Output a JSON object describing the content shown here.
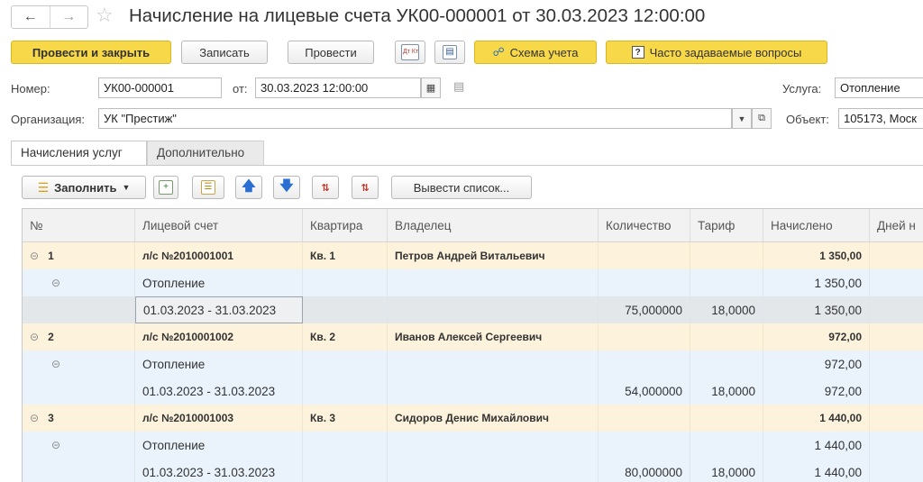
{
  "window": {
    "title": "Начисление на лицевые счета УК00-000001 от 30.03.2023 12:00:00",
    "back_icon": "arrow-left-icon",
    "forward_icon": "arrow-right-icon",
    "favorite_icon": "star-icon"
  },
  "toolbar": {
    "post_close": "Провести и закрыть",
    "save": "Записать",
    "post": "Провести",
    "dtkt_icon": "Дт Кт",
    "structure_icon": "structure-icon",
    "scheme": "Схема учета",
    "faq": "Часто задаваемые вопросы"
  },
  "form": {
    "number_label": "Номер:",
    "number_value": "УК00-000001",
    "date_label": "от:",
    "date_value": "30.03.2023 12:00:00",
    "service_label": "Услуга:",
    "service_value": "Отопление",
    "org_label": "Организация:",
    "org_value": "УК \"Престиж\"",
    "object_label": "Объект:",
    "object_value": "105173, Моск"
  },
  "tabs": [
    "Начисления услуг",
    "Дополнительно"
  ],
  "table_toolbar": {
    "fill": "Заполнить",
    "export": "Вывести список..."
  },
  "table": {
    "columns": [
      "№",
      "Лицевой счет",
      "Квартира",
      "Владелец",
      "Количество",
      "Тариф",
      "Начислено",
      "Дней н"
    ],
    "rows": [
      {
        "type": "account",
        "num": "1",
        "account": "л/с №2010001001",
        "flat": "Кв. 1",
        "owner": "Петров Андрей Витальевич",
        "qty": "",
        "tariff": "",
        "accrued": "1 350,00"
      },
      {
        "type": "service",
        "num": "",
        "account": "Отопление",
        "flat": "",
        "owner": "",
        "qty": "",
        "tariff": "",
        "accrued": "1 350,00"
      },
      {
        "type": "period",
        "num": "",
        "account": "01.03.2023 - 31.03.2023",
        "flat": "",
        "owner": "",
        "qty": "75,000000",
        "tariff": "18,0000",
        "accrued": "1 350,00"
      },
      {
        "type": "account",
        "num": "2",
        "account": "л/с №2010001002",
        "flat": "Кв. 2",
        "owner": "Иванов Алексей Сергеевич",
        "qty": "",
        "tariff": "",
        "accrued": "972,00"
      },
      {
        "type": "service",
        "num": "",
        "account": "Отопление",
        "flat": "",
        "owner": "",
        "qty": "",
        "tariff": "",
        "accrued": "972,00"
      },
      {
        "type": "period",
        "num": "",
        "account": "01.03.2023 - 31.03.2023",
        "flat": "",
        "owner": "",
        "qty": "54,000000",
        "tariff": "18,0000",
        "accrued": "972,00"
      },
      {
        "type": "account",
        "num": "3",
        "account": "л/с №2010001003",
        "flat": "Кв. 3",
        "owner": "Сидоров Денис Михайлович",
        "qty": "",
        "tariff": "",
        "accrued": "1 440,00"
      },
      {
        "type": "service",
        "num": "",
        "account": "Отопление",
        "flat": "",
        "owner": "",
        "qty": "",
        "tariff": "",
        "accrued": "1 440,00"
      },
      {
        "type": "period",
        "num": "",
        "account": "01.03.2023 - 31.03.2023",
        "flat": "",
        "owner": "",
        "qty": "80,000000",
        "tariff": "18,0000",
        "accrued": "1 440,00"
      }
    ]
  },
  "colors": {
    "accent_yellow": "#f7d849",
    "group_row": "#fdf3dc",
    "detail_row": "#eaf2fb"
  }
}
